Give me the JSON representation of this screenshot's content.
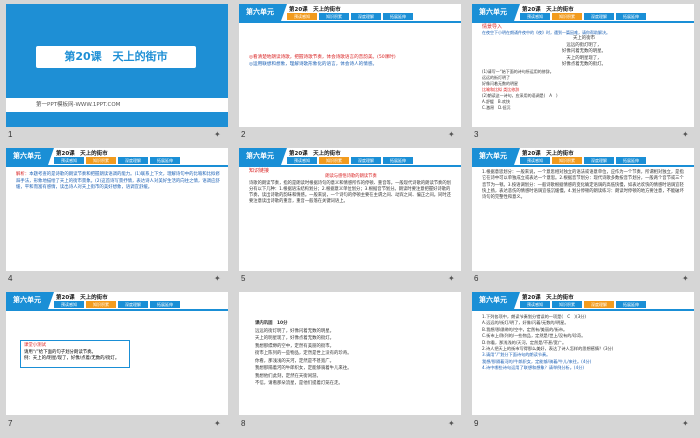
{
  "slides": [
    {
      "num": "1",
      "title": "第20课　天上的街市",
      "footer": "第一PPT模板网-WWW.1PPT.COM"
    },
    {
      "num": "2",
      "unit": "第六单元",
      "lesson": "第20课　天上的街市",
      "tabs": [
        "预读感知",
        "知识积累",
        "深度理解",
        "拓展延伸"
      ],
      "active": 0,
      "lines": [
        "◎看清楚地朗读诗歌，把握诗歌节奏，体会诗歌语言的音韵美。(50课时)",
        "◎运用联想和想象，理解诗歌形象化的语言，体会诗人的情感。"
      ]
    },
    {
      "num": "3",
      "unit": "第六单元",
      "lesson": "第20课　天上的街市",
      "tabs": [
        "预读感知",
        "知识积累",
        "深度理解",
        "拓展延伸"
      ],
      "active": 1,
      "heading": "情景导入",
      "intro": "在夜空下小明在朗诵件夜中的《夜》时，遇到一篇因难，请你帮助解决。",
      "poem": [
        "天上的街市",
        "远远的街灯明了，",
        "好像闪着无数的明星。",
        "天上的明星现了，",
        "好像点着无数的街灯。"
      ],
      "q1": "(1)请写一“始下面的诗句所运用的修辞。",
      "q1a": "远远的街灯明了",
      "q1b": "好像闪着无数的明星",
      "q2label": "比喻和比拟  类比修辞",
      "q2": "(2)朗读这一诗句，应采用的语调是(　A　)",
      "opts": [
        "A.舒缓　B.欢快",
        "C.激昂　D.低沉"
      ]
    },
    {
      "num": "4",
      "unit": "第六单元",
      "lesson": "第20课　天上的街市",
      "tabs": [
        "预读感知",
        "知识积累",
        "深度理解",
        "拓展延伸"
      ],
      "active": 1,
      "prefix": "解析：",
      "text": "本题考查的是诗歌的朗读节奏和把握朗读语调的能力。(1)联系上下文，理解诗句中的比喻和比拟修辞手法，形象地描绘了天上的街市景象。(2)这首诗写景抒情，表达诗人对美好生活的向往之情，语调应舒缓，平和而富有感情，读出诗人对天上街市的美好想象，语调宜舒缓。"
    },
    {
      "num": "5",
      "unit": "第六单元",
      "lesson": "第20课　天上的街市",
      "tabs": [
        "预读感知",
        "知识积累",
        "深度理解",
        "拓展延伸"
      ],
      "active": 1,
      "heading": "知识链接",
      "subheading": "朗读与感悟诗歌的朗读节奏",
      "text": "诗歌的朗读节奏，指的是朗读时根据诗句的意义和情感所作的停顿、重音等。一般现代诗歌的朗读节奏的划分有以下几种：1.根据语法结构划分；2.根据意义单位划分；3.根据音节划分。朗读时要注意把握好诗歌的节奏，读出诗歌的韵味和情感。一般来说，一个诗句的停顿主要在主谓之间、动宾之间、偏正之间。同时还要注意读出诗歌的重音，重音一般落在关键词语上。"
    },
    {
      "num": "6",
      "unit": "第六单元",
      "lesson": "第20课　天上的街市",
      "tabs": [
        "预读感知",
        "知识积累",
        "深度理解",
        "拓展延伸"
      ],
      "active": 1,
      "text": "1.根据意思划分：一般来说，一个意思相对独立的语法或语意单位，应作为一个节奏，所谓相对独立，是指它在诗中可以单独成立或表达一个意思。2.根据音节划分：现代诗歌多数按音节划分，一般两个音节或三个音节为一顿。3.按语调划分：一般诗歌根据情感的变化确定语调的高低快慢，如表达欢快的情感时语调宜轻快上扬，表达悲伤的情感时语调宜低沉缓慢。4.划分停顿的朗读练习：朗读时停顿的地方要注意，不能破坏诗句的完整性和意义。"
    },
    {
      "num": "7",
      "unit": "第六单元",
      "lesson": "第20课　天上的街市",
      "tabs": [
        "预读感知",
        "知识积累",
        "深度理解",
        "拓展延伸"
      ],
      "active": 1,
      "box_title": "课堂小测试",
      "box_lines": [
        "请用“/”给下面的句子划分朗读节奏。",
        "例：天上的/明星/现了，好像/点着/无数的/街灯。"
      ]
    },
    {
      "num": "8",
      "unit": "",
      "lesson": "",
      "tabs": [],
      "active": -1,
      "heading": "课内巩固　10分",
      "poem": [
        "远远的街灯明了，好像闪着无数的明星。",
        "天上的明星现了，好像点着无数的街灯。",
        "我想那缥缈的空中，定然有美丽的街市。",
        "街市上陈列的一些物品，定然是世上没有的珍奇。",
        "你看，那浅浅的天河，定然是不甚宽广。",
        "我想那隔着河的牛郎织女，定能够骑着牛儿来往。",
        "我想他们此刻，定然在天街闲游。",
        "不信，请看那朵流星，是他们提着灯笼在走。"
      ]
    },
    {
      "num": "9",
      "unit": "第六单元",
      "lesson": "第20课　天上的街市",
      "tabs": [
        "预读感知",
        "知识积累",
        "深度理解",
        "拓展延伸"
      ],
      "active": 2,
      "q": [
        "1.下列各项中，朗读节奏划分错误的一项是(　C　)(3分)",
        "A.远远的/街灯/明了，好像/闪着/无数的/明星。",
        "B.我想/那缥缈的/空中，定然有/美丽的/街市。",
        "C.街市上/陈列的/一些物品，定然是/世上/没有的/珍奇。",
        "D.你看，那浅浅的/天河，定然是/不甚/宽广。",
        "2.诗人把天上的街市写得那么美好，表达了诗人怎样的思想感情？(3分)",
        "3.请用“/”划分下面诗句的朗读节奏。",
        "我想/那隔着河的/牛郎织女，定能够/骑着/牛儿/来往。(4分)",
        "4.诗中哪些诗句运用了联想和想象？请举例分析。(4分)"
      ]
    }
  ]
}
